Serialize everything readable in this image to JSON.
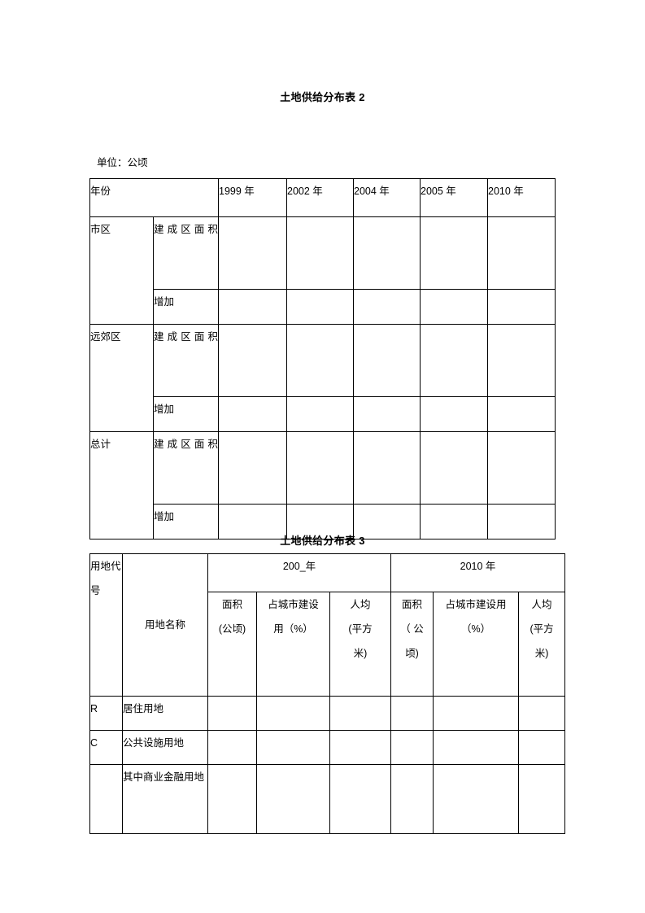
{
  "document": {
    "table2": {
      "title": "土地供给分布表 2",
      "unit_note": "单位：公顷",
      "header": {
        "row_label": "年份",
        "years": [
          "1999 年",
          "2002 年",
          "2004 年",
          "2005 年",
          "2010 年"
        ]
      },
      "groups": [
        {
          "name": "市区",
          "metrics": [
            "建成区面积",
            "增加"
          ],
          "values": [
            [
              "",
              "",
              "",
              "",
              ""
            ],
            [
              "",
              "",
              "",
              "",
              ""
            ]
          ]
        },
        {
          "name": "远郊区",
          "metrics": [
            "建成区面积",
            "增加"
          ],
          "values": [
            [
              "",
              "",
              "",
              "",
              ""
            ],
            [
              "",
              "",
              "",
              "",
              ""
            ]
          ]
        },
        {
          "name": "总计",
          "metrics": [
            "建成区面积",
            "增加"
          ],
          "values": [
            [
              "",
              "",
              "",
              "",
              ""
            ],
            [
              "",
              "",
              "",
              "",
              ""
            ]
          ]
        }
      ]
    },
    "table3": {
      "title": "土地供给分布表 3",
      "header": {
        "code_label": "用地代号",
        "name_label": "用地名称",
        "period_a": "200_年",
        "period_b": "2010 年",
        "sub_a": {
          "area_line1": "面积",
          "area_line2": "(公顷)",
          "share_line1": "占城市建设",
          "share_line2": "用（%）",
          "percapita_line1": "人均",
          "percapita_line2": "(平方",
          "percapita_line3": "米)"
        },
        "sub_b": {
          "area_line1": "面积",
          "area_line2": "（   公",
          "area_line3": "顷)",
          "share_line1": "占城市建设用",
          "share_line2": "（%）",
          "percapita_line1": "人均",
          "percapita_line2": "(平方",
          "percapita_line3": "米)"
        }
      },
      "rows": [
        {
          "code": "R",
          "name": "居住用地",
          "values": [
            "",
            "",
            "",
            "",
            "",
            ""
          ]
        },
        {
          "code": "C",
          "name": "公共设施用地",
          "values": [
            "",
            "",
            "",
            "",
            "",
            ""
          ]
        },
        {
          "code": "",
          "name": "其中商业金融用地",
          "values": [
            "",
            "",
            "",
            "",
            "",
            ""
          ]
        }
      ]
    }
  }
}
